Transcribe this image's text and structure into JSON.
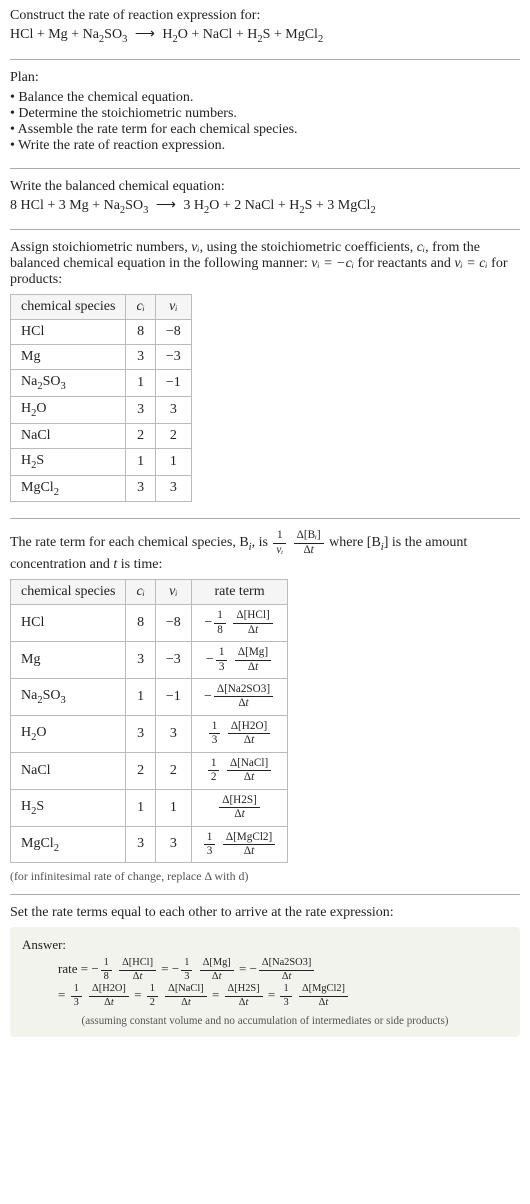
{
  "header": {
    "title": "Construct the rate of reaction expression for:",
    "equation_lhs": [
      "HCl",
      "Mg",
      "Na₂SO₃"
    ],
    "equation_rhs": [
      "H₂O",
      "NaCl",
      "H₂S",
      "MgCl₂"
    ]
  },
  "plan": {
    "title": "Plan:",
    "items": [
      "Balance the chemical equation.",
      "Determine the stoichiometric numbers.",
      "Assemble the rate term for each chemical species.",
      "Write the rate of reaction expression."
    ]
  },
  "balanced": {
    "title": "Write the balanced chemical equation:",
    "lhs": [
      {
        "coef": "8",
        "species": "HCl"
      },
      {
        "coef": "3",
        "species": "Mg"
      },
      {
        "coef": "",
        "species": "Na₂SO₃"
      }
    ],
    "rhs": [
      {
        "coef": "3",
        "species": "H₂O"
      },
      {
        "coef": "2",
        "species": "NaCl"
      },
      {
        "coef": "",
        "species": "H₂S"
      },
      {
        "coef": "3",
        "species": "MgCl₂"
      }
    ]
  },
  "stoich": {
    "intro_a": "Assign stoichiometric numbers, ",
    "intro_b": ", using the stoichiometric coefficients, ",
    "intro_c": ", from the balanced chemical equation in the following manner: ",
    "intro_d": " for reactants and ",
    "intro_e": " for products:",
    "nu": "νᵢ",
    "ci": "cᵢ",
    "rel_react": "νᵢ = −cᵢ",
    "rel_prod": "νᵢ = cᵢ",
    "headers": [
      "chemical species",
      "cᵢ",
      "νᵢ"
    ],
    "rows": [
      {
        "species": "HCl",
        "c": "8",
        "nu": "−8"
      },
      {
        "species": "Mg",
        "c": "3",
        "nu": "−3"
      },
      {
        "species": "Na₂SO₃",
        "c": "1",
        "nu": "−1"
      },
      {
        "species": "H₂O",
        "c": "3",
        "nu": "3"
      },
      {
        "species": "NaCl",
        "c": "2",
        "nu": "2"
      },
      {
        "species": "H₂S",
        "c": "1",
        "nu": "1"
      },
      {
        "species": "MgCl₂",
        "c": "3",
        "nu": "3"
      }
    ]
  },
  "rateterm": {
    "intro_a": "The rate term for each chemical species, B",
    "intro_b": ", is ",
    "intro_c": " where [B",
    "intro_d": "] is the amount concentration and ",
    "intro_e": " is time:",
    "t": "t",
    "headers": [
      "chemical species",
      "cᵢ",
      "νᵢ",
      "rate term"
    ],
    "rows": [
      {
        "species": "HCl",
        "c": "8",
        "nu": "−8",
        "rn": "1",
        "rd": "8",
        "dnum": "Δ[HCl]",
        "neg": true
      },
      {
        "species": "Mg",
        "c": "3",
        "nu": "−3",
        "rn": "1",
        "rd": "3",
        "dnum": "Δ[Mg]",
        "neg": true
      },
      {
        "species": "Na₂SO₃",
        "c": "1",
        "nu": "−1",
        "rn": "",
        "rd": "",
        "dnum": "Δ[Na2SO3]",
        "neg": true
      },
      {
        "species": "H₂O",
        "c": "3",
        "nu": "3",
        "rn": "1",
        "rd": "3",
        "dnum": "Δ[H2O]",
        "neg": false
      },
      {
        "species": "NaCl",
        "c": "2",
        "nu": "2",
        "rn": "1",
        "rd": "2",
        "dnum": "Δ[NaCl]",
        "neg": false
      },
      {
        "species": "H₂S",
        "c": "1",
        "nu": "1",
        "rn": "",
        "rd": "",
        "dnum": "Δ[H2S]",
        "neg": false
      },
      {
        "species": "MgCl₂",
        "c": "3",
        "nu": "3",
        "rn": "1",
        "rd": "3",
        "dnum": "Δ[MgCl2]",
        "neg": false
      }
    ],
    "footnote": "(for infinitesimal rate of change, replace Δ with d)"
  },
  "final": {
    "intro": "Set the rate terms equal to each other to arrive at the rate expression:",
    "answer_label": "Answer:",
    "rate_label": "rate",
    "note": "(assuming constant volume and no accumulation of intermediates or side products)",
    "line1": [
      {
        "neg": true,
        "rn": "1",
        "rd": "8",
        "dnum": "Δ[HCl]"
      },
      {
        "neg": true,
        "rn": "1",
        "rd": "3",
        "dnum": "Δ[Mg]"
      },
      {
        "neg": true,
        "rn": "",
        "rd": "",
        "dnum": "Δ[Na2SO3]"
      }
    ],
    "line2": [
      {
        "neg": false,
        "rn": "1",
        "rd": "3",
        "dnum": "Δ[H2O]"
      },
      {
        "neg": false,
        "rn": "1",
        "rd": "2",
        "dnum": "Δ[NaCl]"
      },
      {
        "neg": false,
        "rn": "",
        "rd": "",
        "dnum": "Δ[H2S]"
      },
      {
        "neg": false,
        "rn": "1",
        "rd": "3",
        "dnum": "Δ[MgCl2]"
      }
    ]
  },
  "glyphs": {
    "dt": "Δt",
    "arrow": "⟶",
    "eq": "=",
    "plus": "+",
    "minus": "−"
  }
}
